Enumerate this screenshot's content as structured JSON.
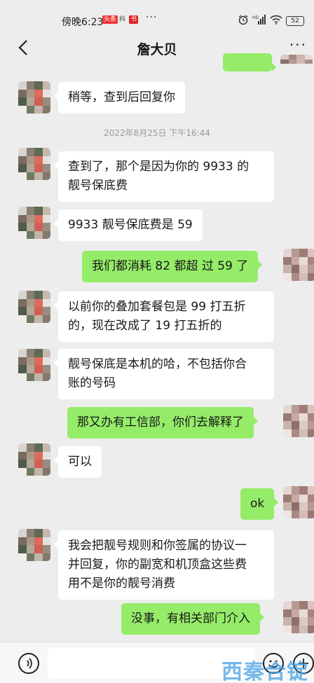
{
  "status_bar": {
    "time": "傍晚6:23",
    "more": "···",
    "battery": "52",
    "network": "HD"
  },
  "header": {
    "title": "詹大贝"
  },
  "timestamp": "2022年8月25日 下午16:44",
  "messages": [
    {
      "side": "left",
      "text": "稍等，查到后回复你"
    },
    {
      "side": "left",
      "text": "查到了，那个是因为你的 9933 的\n靓号保底费"
    },
    {
      "side": "left",
      "text": "9933 靓号保底费是 59"
    },
    {
      "side": "right",
      "text": "我们都消耗 82 都超 过 59 了"
    },
    {
      "side": "left",
      "text": "以前你的叠加套餐包是 99 打五折\n的，现在改成了 19 打五折的"
    },
    {
      "side": "left",
      "text": "靓号保底是本机的哈，不包括你合\n账的号码"
    },
    {
      "side": "right",
      "text": "那又办有工信部，你们去解释了"
    },
    {
      "side": "left",
      "text": "可以"
    },
    {
      "side": "right",
      "text": "ok"
    },
    {
      "side": "left",
      "text": "我会把靓号规则和你签属的协议一\n并回复，你的副宽和机顶盒这些费\n用不是你的靓号消费"
    },
    {
      "side": "right",
      "text": "没事，有相关部门介入"
    }
  ],
  "watermark": "西秦合锭",
  "colors": {
    "background": "#ededed",
    "bubble_self": "#95ec69",
    "bubble_other": "#ffffff"
  }
}
